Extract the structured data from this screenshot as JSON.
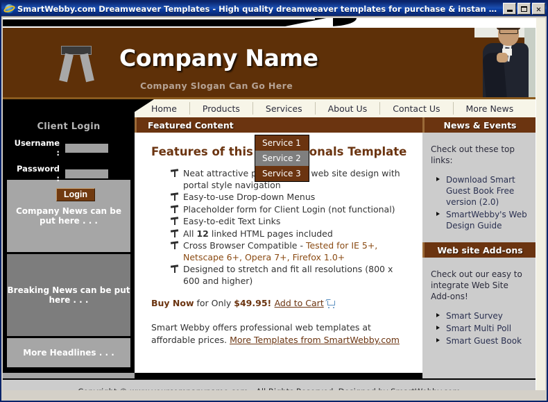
{
  "window": {
    "title": "SmartWebby.com Dreamweaver Templates - High quality dreamweaver templates for purchase & instan - Windows Interne...",
    "icon": "internet-explorer-icon",
    "minimize_label": "Minimize",
    "maximize_label": "Maximize",
    "close_label": "Close"
  },
  "banner": {
    "company_name": "Company Name",
    "slogan": "Company Slogan Can Go Here",
    "logo_icon": "company-logo-icon",
    "photo_alt": "businessman-photo"
  },
  "nav": {
    "items": [
      {
        "label": "Home"
      },
      {
        "label": "Products"
      },
      {
        "label": "Services"
      },
      {
        "label": "About Us"
      },
      {
        "label": "Contact Us"
      },
      {
        "label": "More News"
      }
    ]
  },
  "dropdown": {
    "open_for": "Services",
    "items": [
      {
        "label": "Service 1",
        "highlighted": false
      },
      {
        "label": "Service 2",
        "highlighted": true
      },
      {
        "label": "Service 3",
        "highlighted": false
      }
    ]
  },
  "login": {
    "title": "Client Login",
    "username_label": "Username :",
    "password_label": "Password :",
    "username_value": "",
    "password_value": "",
    "username_placeholder": "",
    "password_placeholder": "",
    "button_label": "Login"
  },
  "left_news": {
    "blocks": [
      {
        "text": "Company News can be put here . . ."
      },
      {
        "text": "Breaking News can be put here . . ."
      },
      {
        "text": "More Headlines  . . ."
      }
    ]
  },
  "main": {
    "section_title": "Featured Content",
    "heading": "Features of this Professionals Template",
    "features": [
      {
        "text": "Neat attractive professionals web site design with portal style navigation"
      },
      {
        "text": "Easy-to-use Drop-down Menus"
      },
      {
        "text": "Placeholder form for Client Login (not functional)"
      },
      {
        "text": "Easy-to-edit Text Links"
      },
      {
        "text": "All 12 linked HTML pages included",
        "bold_part": "12"
      },
      {
        "text": "Cross Browser Compatible - Tested for IE 5+, Netscape 6+, Opera 7+, Firefox 1.0+",
        "plain_part": "Cross Browser Compatible - ",
        "accent_part": "Tested for IE 5+, Netscape 6+, Opera 7+, Firefox 1.0+"
      },
      {
        "text": "Designed to stretch and fit all resolutions (800 x 600 and higher)"
      }
    ],
    "buy_prefix": "Buy Now",
    "buy_middle": " for Only ",
    "price": "$49.95",
    "buy_suffix": "! ",
    "add_to_cart_label": "Add to Cart",
    "cart_icon": "shopping-cart-icon",
    "blurb_text": "Smart Webby offers professional web templates at affordable prices. ",
    "blurb_link": "More Templates from SmartWebby.com"
  },
  "right": {
    "news_title": "News & Events",
    "news_intro": "Check out these top links:",
    "news_links": [
      {
        "label": "Download Smart Guest Book Free version (2.0)"
      },
      {
        "label": "SmartWebby's Web Design Guide"
      }
    ],
    "addons_title": "Web site Add-ons",
    "addons_intro": "Check out our easy to integrate Web Site Add-ons!",
    "addons_links": [
      {
        "label": "Smart Survey"
      },
      {
        "label": "Smart Multi Poll"
      },
      {
        "label": "Smart Guest Book"
      }
    ]
  },
  "footer": {
    "copyright": "Copyright © www.yourcompanyname.com - All Rights Reserved. Designed by SmartWebby.com"
  },
  "colors": {
    "brand_brown": "#6b3410",
    "banner_brown": "#5e3008",
    "titlebar_blue": "#0a246a",
    "sidebar_gray": "#a6a6a6",
    "sidebar_gray_dark": "#7d7d7d",
    "right_gray": "#cccccc",
    "nav_cream": "#f7f5e8",
    "dropdown_highlight": "#7f7f7f"
  }
}
